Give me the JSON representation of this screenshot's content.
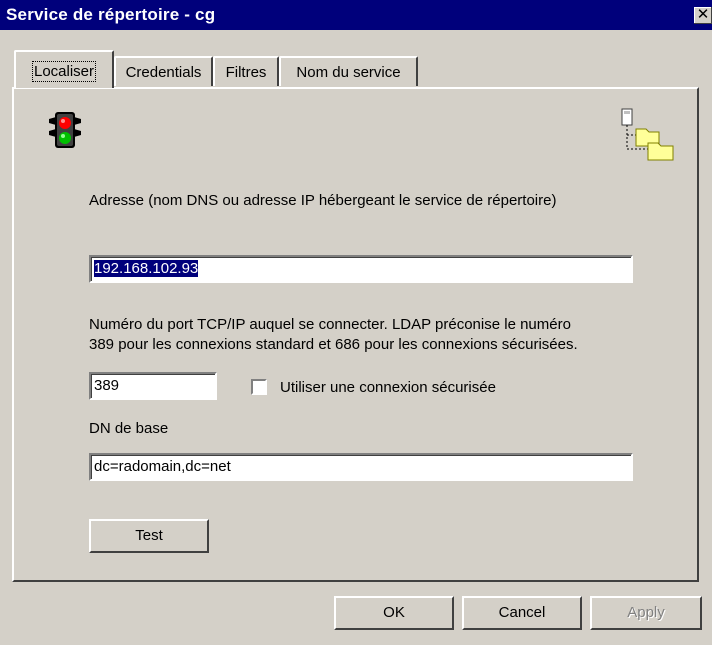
{
  "window": {
    "title": "Service de répertoire - cg",
    "close_glyph": "✕"
  },
  "tabs": [
    {
      "label": "Localiser",
      "active": true
    },
    {
      "label": "Credentials",
      "active": false
    },
    {
      "label": "Filtres",
      "active": false
    },
    {
      "label": "Nom du service",
      "active": false
    }
  ],
  "icons": {
    "status": "traffic-light-icon",
    "directory": "directory-tree-icon"
  },
  "address": {
    "label": "Adresse (nom DNS ou adresse IP hébergeant le service de répertoire)",
    "value": "192.168.102.93"
  },
  "port": {
    "description_line1": "Numéro du port TCP/IP auquel se connecter. LDAP préconise le numéro",
    "description_line2": "389 pour les connexions standard et 686 pour les connexions sécurisées.",
    "value": "389"
  },
  "secure": {
    "label": "Utiliser une connexion sécurisée",
    "checked": false
  },
  "base_dn": {
    "label": "DN de base",
    "value": "dc=radomain,dc=net"
  },
  "buttons": {
    "test": "Test",
    "ok": "OK",
    "cancel": "Cancel",
    "apply": "Apply"
  }
}
